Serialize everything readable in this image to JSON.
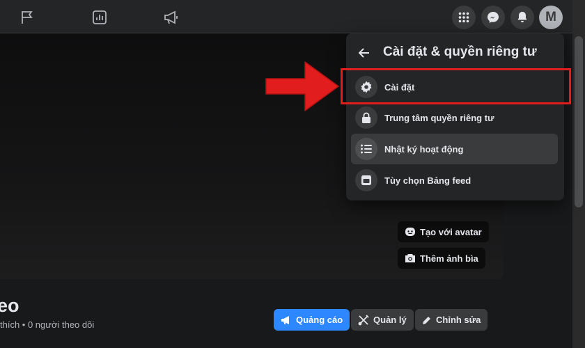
{
  "colors": {
    "accent": "#2d88ff",
    "annotation_red": "#e11d1d",
    "surface": "#242526",
    "background": "#18191a"
  },
  "topbar": {
    "nav_icons": [
      "flag-icon",
      "insights-chart-icon",
      "megaphone-icon"
    ],
    "right_buttons": [
      "menu-grid-icon",
      "messenger-icon",
      "notifications-bell-icon"
    ],
    "avatar_letter": "M"
  },
  "cover": {
    "create_avatar_label": "Tạo với avatar",
    "add_cover_label": "Thêm ảnh bìa"
  },
  "page": {
    "name": "eo",
    "stats": "thích • 0 người theo dõi"
  },
  "actions": {
    "ads_label": "Quảng cáo",
    "manage_label": "Quản lý",
    "edit_label": "Chỉnh sửa"
  },
  "dropdown": {
    "title": "Cài đặt & quyền riêng tư",
    "items": [
      {
        "label": "Cài đặt",
        "icon": "gear-icon"
      },
      {
        "label": "Trung tâm quyền riêng tư",
        "icon": "lock-icon"
      },
      {
        "label": "Nhật ký hoạt động",
        "icon": "list-icon"
      },
      {
        "label": "Tùy chọn Bảng feed",
        "icon": "feed-icon"
      }
    ]
  }
}
